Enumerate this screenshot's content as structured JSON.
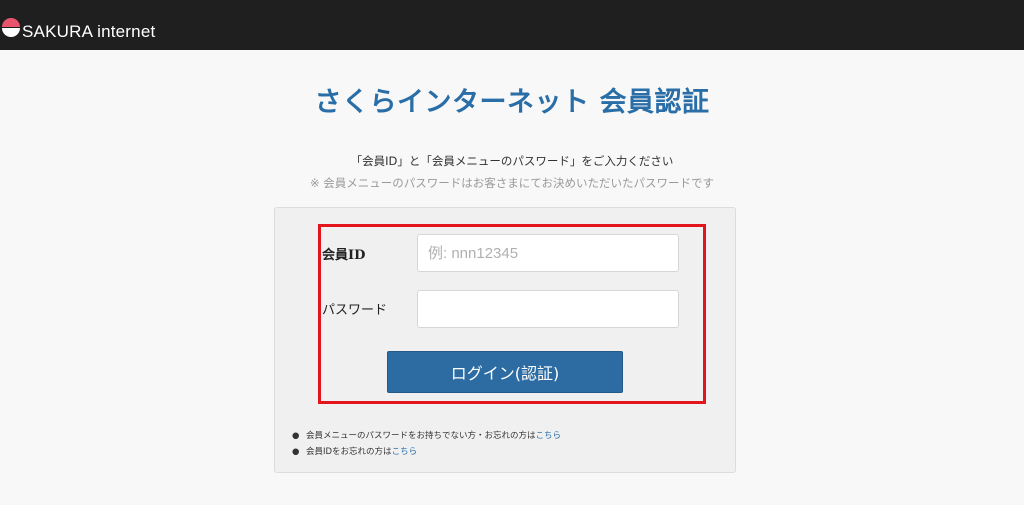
{
  "header": {
    "logo_text": "SAKURA internet",
    "bg_color": "#1f1f20"
  },
  "page": {
    "title": "さくらインターネット 会員認証",
    "instruction": "「会員ID」と「会員メニューのパスワード」をご入力ください",
    "note": "※ 会員メニューのパスワードはお客さまにてお決めいただいたパスワードです"
  },
  "form": {
    "member_id_label": "会員ID",
    "member_id_placeholder": "例: nnn12345",
    "member_id_value": "",
    "password_label": "パスワード",
    "password_value": "",
    "login_button_label": "ログイン(認証)"
  },
  "help": {
    "items": [
      {
        "text": "会員メニューのパスワードをお持ちでない方・お忘れの方は",
        "link": "こちら"
      },
      {
        "text": "会員IDをお忘れの方は",
        "link": "こちら"
      }
    ]
  },
  "colors": {
    "accent": "#2a6ea7",
    "button": "#2c6ca3",
    "highlight": "#e3141c"
  }
}
